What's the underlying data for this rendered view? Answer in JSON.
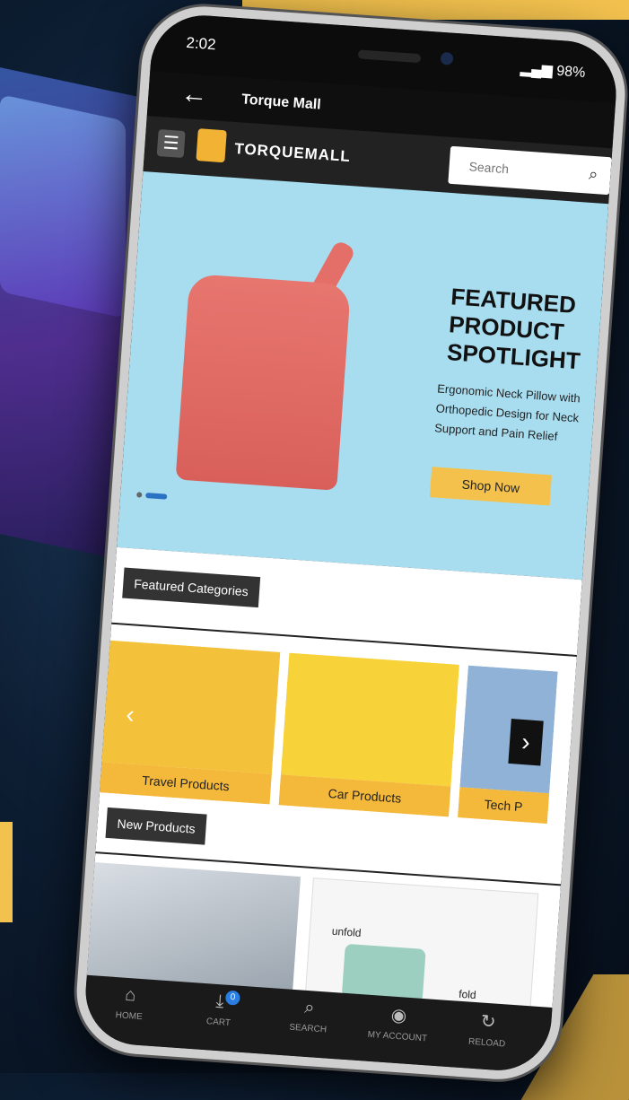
{
  "status_bar": {
    "time": "2:02",
    "battery": "98%"
  },
  "app_bar": {
    "title": "Torque Mall"
  },
  "header": {
    "logo_text": "TORQUEMALL",
    "search_placeholder": "Search"
  },
  "banner": {
    "title_line1": "FEATURED",
    "title_line2": "PRODUCT",
    "title_line3": "SPOTLIGHT",
    "subtitle": "Ergonomic Neck Pillow with Orthopedic Design for Neck Support and Pain Relief",
    "cta": "Shop Now"
  },
  "featured_categories": {
    "label": "Featured Categories",
    "items": [
      {
        "label": "Travel Products"
      },
      {
        "label": "Car Products"
      },
      {
        "label": "Tech P"
      }
    ]
  },
  "new_products": {
    "label": "New Products",
    "items": [
      {
        "caption": ""
      },
      {
        "caption_unfold": "unfold",
        "caption_fold": "fold"
      }
    ]
  },
  "bottom_nav": [
    {
      "label": "HOME"
    },
    {
      "label": "CART",
      "badge": "0"
    },
    {
      "label": "SEARCH"
    },
    {
      "label": "MY ACCOUNT"
    },
    {
      "label": "RELOAD"
    }
  ],
  "colors": {
    "accent": "#f4b83a",
    "banner_bg": "#a8ddf0",
    "nav_bg": "#1a1a1a",
    "badge": "#2a7de1"
  }
}
